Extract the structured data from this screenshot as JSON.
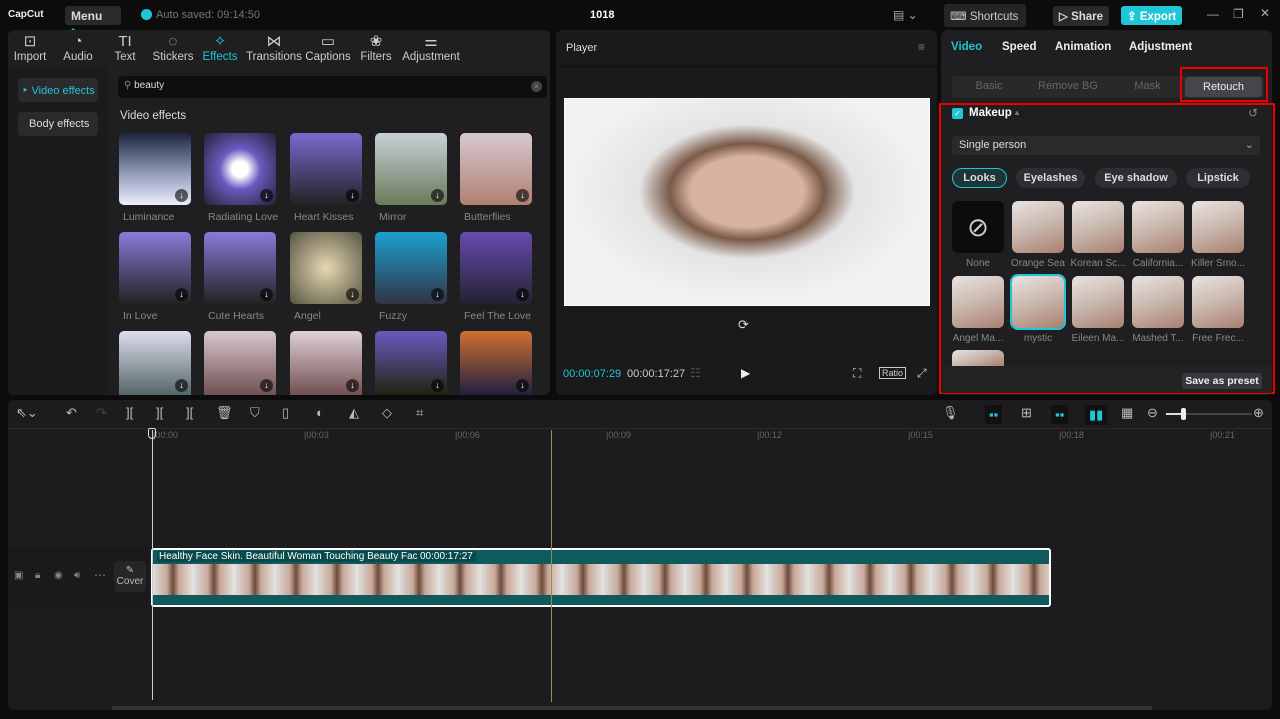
{
  "topbar": {
    "logo": "CapCut",
    "menu": "Menu",
    "autosave": "Auto saved: 09:14:50",
    "project": "1018",
    "shortcuts": "Shortcuts",
    "share": "Share",
    "export": "Export"
  },
  "tabs": [
    {
      "label": "Import",
      "icon": "import-icon"
    },
    {
      "label": "Audio",
      "icon": "audio-icon"
    },
    {
      "label": "Text",
      "icon": "text-icon"
    },
    {
      "label": "Stickers",
      "icon": "stickers-icon"
    },
    {
      "label": "Effects",
      "icon": "effects-icon"
    },
    {
      "label": "Transitions",
      "icon": "transitions-icon"
    },
    {
      "label": "Captions",
      "icon": "captions-icon"
    },
    {
      "label": "Filters",
      "icon": "filters-icon"
    },
    {
      "label": "Adjustment",
      "icon": "adjustment-icon"
    }
  ],
  "sidebar": {
    "video_effects": "Video effects",
    "body_effects": "Body effects"
  },
  "search": {
    "value": "beauty"
  },
  "section_title": "Video effects",
  "effects": [
    "Luminance",
    "Radiating Love",
    "Heart Kisses",
    "Mirror",
    "Butterflies",
    "In Love",
    "Cute Hearts",
    "Angel",
    "Fuzzy",
    "Feel The Love",
    "",
    "",
    "",
    "",
    ""
  ],
  "player": {
    "title": "Player",
    "current": "00:00:07:29",
    "total": "00:00:17:27",
    "ratio": "Ratio"
  },
  "right": {
    "tabs": [
      "Video",
      "Speed",
      "Animation",
      "Adjustment"
    ],
    "subtabs": [
      "Basic",
      "Remove BG",
      "Mask",
      "Retouch"
    ],
    "makeup": "Makeup",
    "person": "Single person",
    "pills": [
      "Looks",
      "Eyelashes",
      "Eye shadow",
      "Lipstick"
    ],
    "looks": [
      "None",
      "Orange Sea",
      "Korean Sc...",
      "California...",
      "Killer Smo...",
      "Angel Ma...",
      "mystic",
      "Eileen Ma...",
      "Mashed T...",
      "Free Frec..."
    ],
    "save_preset": "Save as preset"
  },
  "timeline": {
    "ticks": [
      "00:00",
      "00:03",
      "00:06",
      "00:09",
      "00:12",
      "00:15",
      "00:18",
      "00:21"
    ],
    "clip_title": "Healthy Face Skin. Beautiful Woman Touching Beauty Face",
    "clip_duration": "00:00:17:27",
    "cover": "Cover"
  },
  "colors": {
    "accent": "#1fc6d6",
    "clip": "#0f5a5c",
    "highlight": "#e00000"
  }
}
